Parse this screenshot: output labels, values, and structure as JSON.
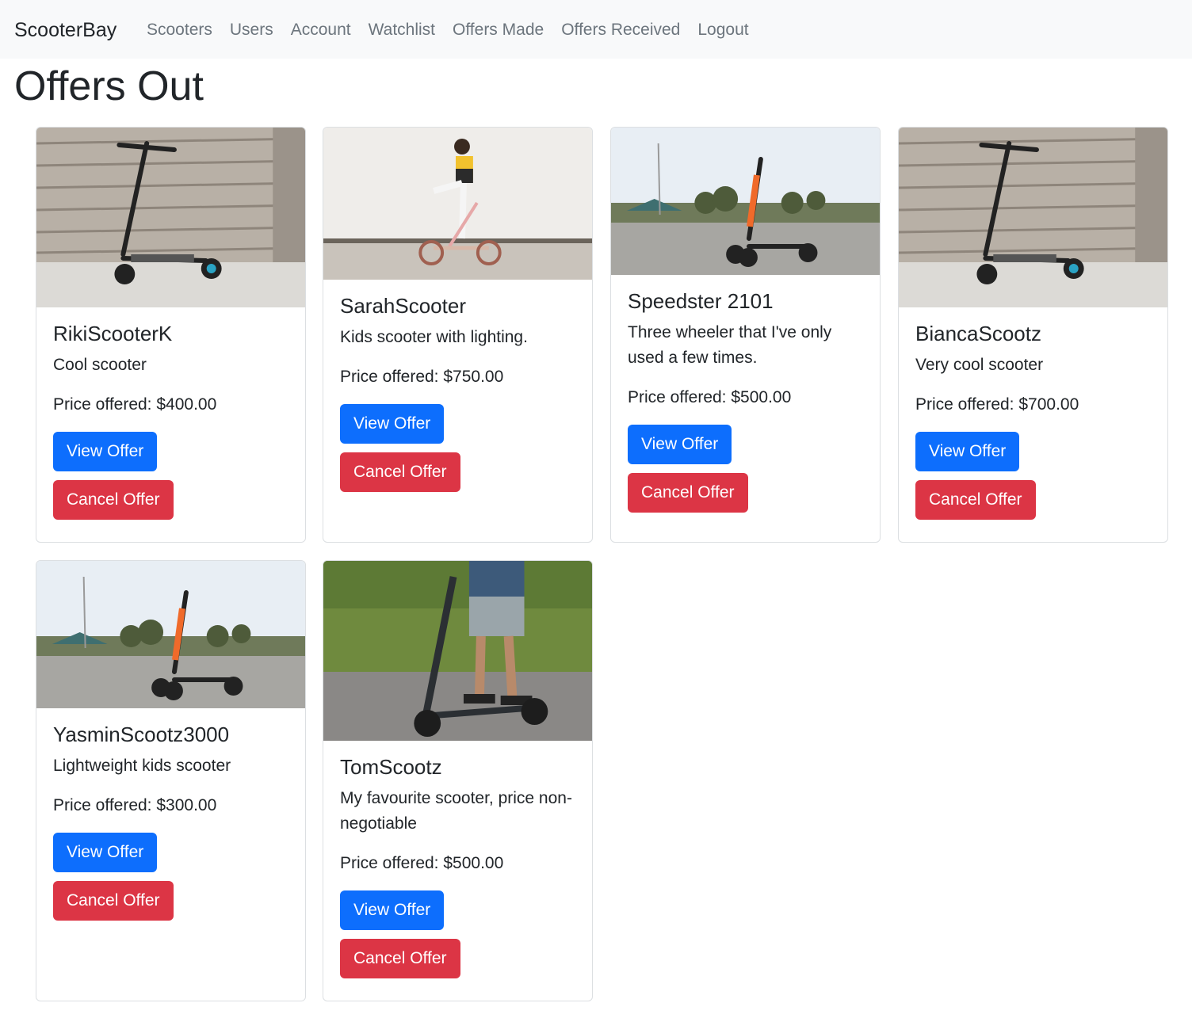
{
  "nav": {
    "brand": "ScooterBay",
    "links": [
      "Scooters",
      "Users",
      "Account",
      "Watchlist",
      "Offers Made",
      "Offers Received",
      "Logout"
    ]
  },
  "page_title": "Offers Out",
  "cards": [
    {
      "title": "RikiScooterK",
      "description": "Cool scooter",
      "price": "Price offered: $400.00",
      "image": "scooter-on-steps-photo",
      "view_label": "View Offer",
      "cancel_label": "Cancel Offer"
    },
    {
      "title": "SarahScooter",
      "description": "Kids scooter with lighting.",
      "price": "Price offered: $750.00",
      "image": "girl-riding-scooter-photo",
      "view_label": "View Offer",
      "cancel_label": "Cancel Offer"
    },
    {
      "title": "Speedster 2101",
      "description": "Three wheeler that I've only used a few times.",
      "price": "Price offered: $500.00",
      "image": "scooter-in-park-photo",
      "view_label": "View Offer",
      "cancel_label": "Cancel Offer"
    },
    {
      "title": "BiancaScootz",
      "description": "Very cool scooter",
      "price": "Price offered: $700.00",
      "image": "scooter-on-steps-photo",
      "view_label": "View Offer",
      "cancel_label": "Cancel Offer"
    },
    {
      "title": "YasminScootz3000",
      "description": "Lightweight kids scooter",
      "price": "Price offered: $300.00",
      "image": "scooter-in-park-photo",
      "view_label": "View Offer",
      "cancel_label": "Cancel Offer"
    },
    {
      "title": "TomScootz",
      "description": "My favourite scooter, price non-negotiable",
      "price": "Price offered: $500.00",
      "image": "man-on-scooter-photo",
      "view_label": "View Offer",
      "cancel_label": "Cancel Offer"
    }
  ],
  "colors": {
    "primary": "#0d6efd",
    "danger": "#dc3545",
    "navbar_bg": "#f8f9fa",
    "nav_link": "#6c757d"
  }
}
